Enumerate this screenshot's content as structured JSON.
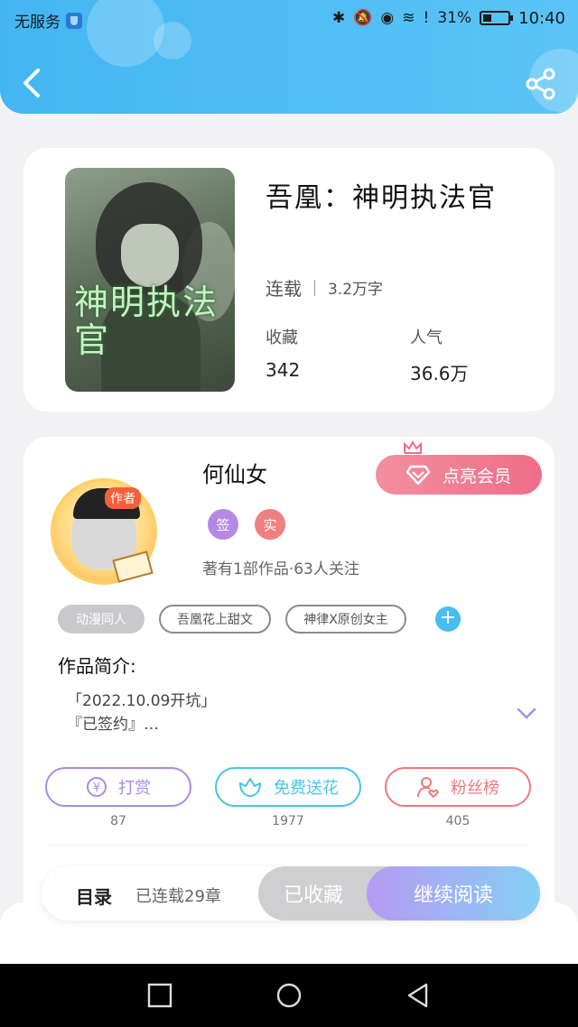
{
  "status_bar": {
    "carrier": "无服务",
    "battery": "31%",
    "time": "10:40"
  },
  "book": {
    "cover_title": "神明执法官",
    "title": "吾凰：神明执法官",
    "status": "连载",
    "word_count": "3.2万字",
    "favorites_label": "收藏",
    "favorites_value": "342",
    "popularity_label": "人气",
    "popularity_value": "36.6万"
  },
  "author": {
    "tag": "作者",
    "name": "何仙女",
    "badges": [
      "签",
      "实"
    ],
    "meta": "著有1部作品·63人关注",
    "vip_label": "点亮会员"
  },
  "tags": [
    "动漫同人",
    "吾凰花上甜文",
    "神律X原创女主"
  ],
  "intro": {
    "heading": "作品简介:",
    "text": "「2022.10.09开坑」\n『已签约』…"
  },
  "actions": [
    {
      "label": "打赏",
      "count": "87",
      "color": "#a98be6"
    },
    {
      "label": "免费送花",
      "count": "1977",
      "color": "#48c4e6"
    },
    {
      "label": "粉丝榜",
      "count": "405",
      "color": "#ec7b7b"
    }
  ],
  "bottom_bar": {
    "catalog_label": "目录",
    "chapter_info": "已连载29章",
    "collected_label": "已收藏",
    "read_label": "继续阅读"
  },
  "colors": {
    "header": "#43b6f2",
    "accent_pink": "#ee6d89",
    "accent_blue": "#46bdf3"
  }
}
